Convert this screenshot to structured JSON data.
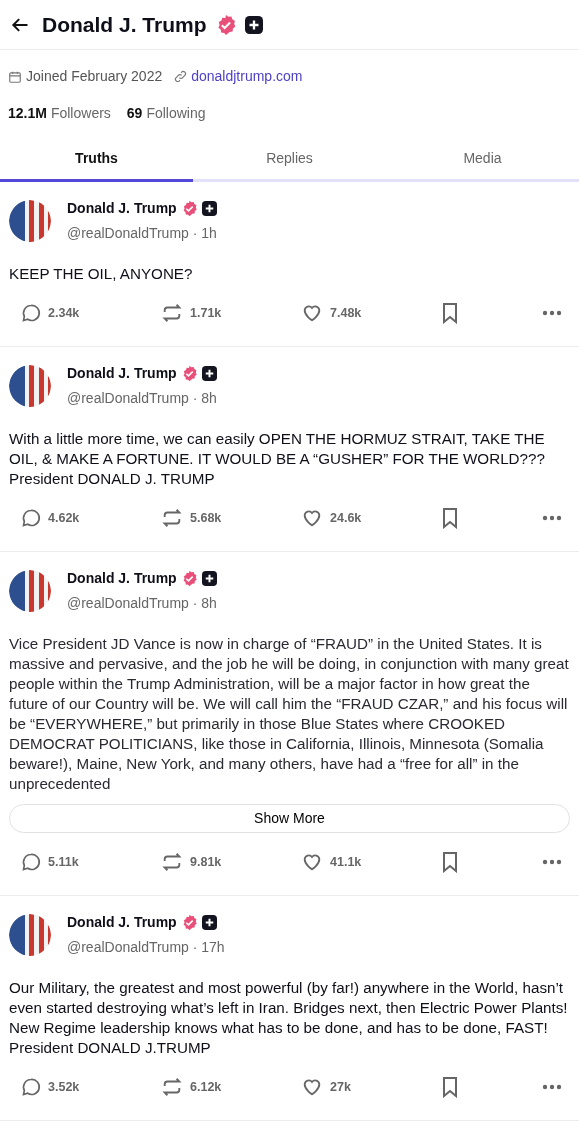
{
  "header": {
    "title": "Donald J. Trump"
  },
  "profile": {
    "joined": "Joined February 2022",
    "website": "donaldjtrump.com",
    "followers_count": "12.1M",
    "followers_label": "Followers",
    "following_count": "69",
    "following_label": "Following"
  },
  "tabs": [
    {
      "label": "Truths",
      "selected": true
    },
    {
      "label": "Replies",
      "selected": false
    },
    {
      "label": "Media",
      "selected": false
    }
  ],
  "posts": [
    {
      "author": "Donald J. Trump",
      "handle_time": "@realDonaldTrump · 1h",
      "text": "KEEP THE OIL, ANYONE?",
      "truncated": false,
      "replies": "2.34k",
      "reposts": "1.71k",
      "likes": "7.48k"
    },
    {
      "author": "Donald J. Trump",
      "handle_time": "@realDonaldTrump · 8h",
      "text": "With a little more time, we can easily OPEN THE HORMUZ STRAIT, TAKE THE OIL, & MAKE A FORTUNE. IT WOULD BE A “GUSHER” FOR THE WORLD??? President DONALD J. TRUMP",
      "truncated": false,
      "replies": "4.62k",
      "reposts": "5.68k",
      "likes": "24.6k"
    },
    {
      "author": "Donald J. Trump",
      "handle_time": "@realDonaldTrump · 8h",
      "text": "Vice President JD Vance is now in charge of “FRAUD” in the United States. It is massive and pervasive, and the job he will be doing, in conjunction with many great people within the Trump Administration, will be a major factor in how great the future of our Country will be. We will call him the “FRAUD CZAR,” and his focus will be “EVERYWHERE,” but primarily in those Blue States where CROOKED DEMOCRAT POLITICIANS, like those in California, Illinois, Minnesota (Somalia beware!), Maine, New York, and many others, have had a “free for all” in the unprecedented",
      "truncated": true,
      "show_more": "Show More",
      "replies": "5.11k",
      "reposts": "9.81k",
      "likes": "41.1k"
    },
    {
      "author": "Donald J. Trump",
      "handle_time": "@realDonaldTrump · 17h",
      "text": "Our Military, the greatest and most powerful (by far!) anywhere in the World, hasn’t even started destroying what’s left in Iran. Bridges next, then Electric Power Plants! New Regime leadership knows what has to be done, and has to be done, FAST! President DONALD J.TRUMP",
      "truncated": false,
      "replies": "3.52k",
      "reposts": "6.12k",
      "likes": "27k"
    }
  ]
}
